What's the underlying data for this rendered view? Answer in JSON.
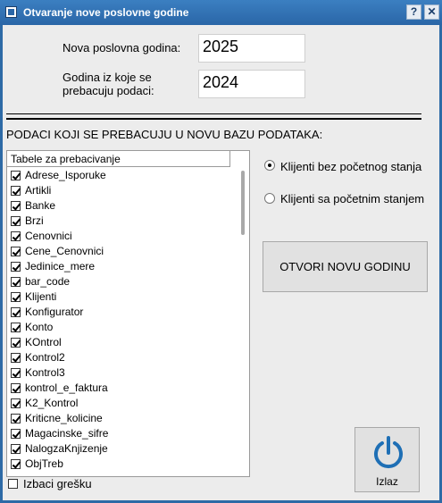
{
  "window": {
    "title": "Otvaranje nove poslovne godine"
  },
  "titlebar": {
    "help_label": "?",
    "close_label": "✕"
  },
  "form": {
    "new_year_label": "Nova poslovna godina:",
    "new_year_value": "2025",
    "source_year_label_line1": "Godina iz koje se",
    "source_year_label_line2": "prebacuju podaci:",
    "source_year_value": "2024"
  },
  "section_title": "PODACI KOJI SE PREBACUJU U NOVU BAZU PODATAKA:",
  "table_list": {
    "header": "Tabele za prebacivanje",
    "items": [
      {
        "label": "Adrese_Isporuke",
        "checked": true
      },
      {
        "label": "Artikli",
        "checked": true
      },
      {
        "label": "Banke",
        "checked": true
      },
      {
        "label": "Brzi",
        "checked": true
      },
      {
        "label": "Cenovnici",
        "checked": true
      },
      {
        "label": "Cene_Cenovnici",
        "checked": true
      },
      {
        "label": "Jedinice_mere",
        "checked": true
      },
      {
        "label": "bar_code",
        "checked": true
      },
      {
        "label": "Klijenti",
        "checked": true
      },
      {
        "label": "Konfigurator",
        "checked": true
      },
      {
        "label": "Konto",
        "checked": true
      },
      {
        "label": "KOntrol",
        "checked": true
      },
      {
        "label": "Kontrol2",
        "checked": true
      },
      {
        "label": "Kontrol3",
        "checked": true
      },
      {
        "label": "kontrol_e_faktura",
        "checked": true
      },
      {
        "label": "K2_Kontrol",
        "checked": true
      },
      {
        "label": "Kriticne_kolicine",
        "checked": true
      },
      {
        "label": "Magacinske_sifre",
        "checked": true
      },
      {
        "label": "NalogzaKnjizenje",
        "checked": true
      },
      {
        "label": "ObjTreb",
        "checked": true
      }
    ]
  },
  "options": {
    "radio_without_balance": "Klijenti bez početnog stanja",
    "radio_with_balance": "Klijenti sa početnim stanjem",
    "selected": "radio_without_balance"
  },
  "buttons": {
    "open_new_year": "OTVORI NOVU GODINU",
    "exit": "Izlaz"
  },
  "footer": {
    "error_checkbox_label": "Izbaci grešku",
    "error_checkbox_checked": false
  },
  "colors": {
    "titlebar": "#2a66a7",
    "accent_icon": "#1e6fb5",
    "client_bg": "#ececec"
  }
}
